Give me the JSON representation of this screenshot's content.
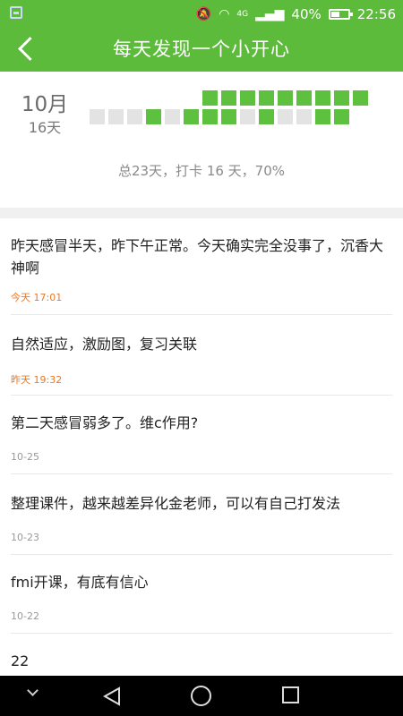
{
  "status_bar": {
    "network": "4G",
    "battery": "40%",
    "time": "22:56"
  },
  "toolbar": {
    "title": "每天发现一个小开心"
  },
  "stats": {
    "month": "10月",
    "days": "16天",
    "summary": "总23天，打卡 16 天，70%"
  },
  "calendar": {
    "colors": {
      "checked": "#5dc13f",
      "unchecked": "#e3e3e3"
    },
    "top_row": [
      1,
      1,
      1,
      1,
      1,
      1,
      1,
      1,
      1
    ],
    "bottom_row": [
      0,
      0,
      0,
      1,
      0,
      1,
      1,
      1,
      0,
      1,
      0,
      0,
      1,
      1
    ]
  },
  "entries": [
    {
      "text": "昨天感冒半天，昨下午正常。今天确实完全没事了，沉香大神啊",
      "time": "今天 17:01",
      "highlight": true
    },
    {
      "text": "自然适应，激励图，复习关联",
      "time": "昨天 19:32",
      "highlight": true
    },
    {
      "text": "第二天感冒弱多了。维c作用?",
      "time": "10-25",
      "highlight": false
    },
    {
      "text": "整理课件，越来越差异化金老师，可以有自己打发法",
      "time": "10-23",
      "highlight": false
    },
    {
      "text": "fmi开课，有底有信心",
      "time": "10-22",
      "highlight": false
    },
    {
      "text": "22",
      "time": "",
      "highlight": false
    }
  ],
  "colors": {
    "header": "#5dbb3c",
    "accent_time": "#e8782a",
    "plain_time": "#999999"
  }
}
